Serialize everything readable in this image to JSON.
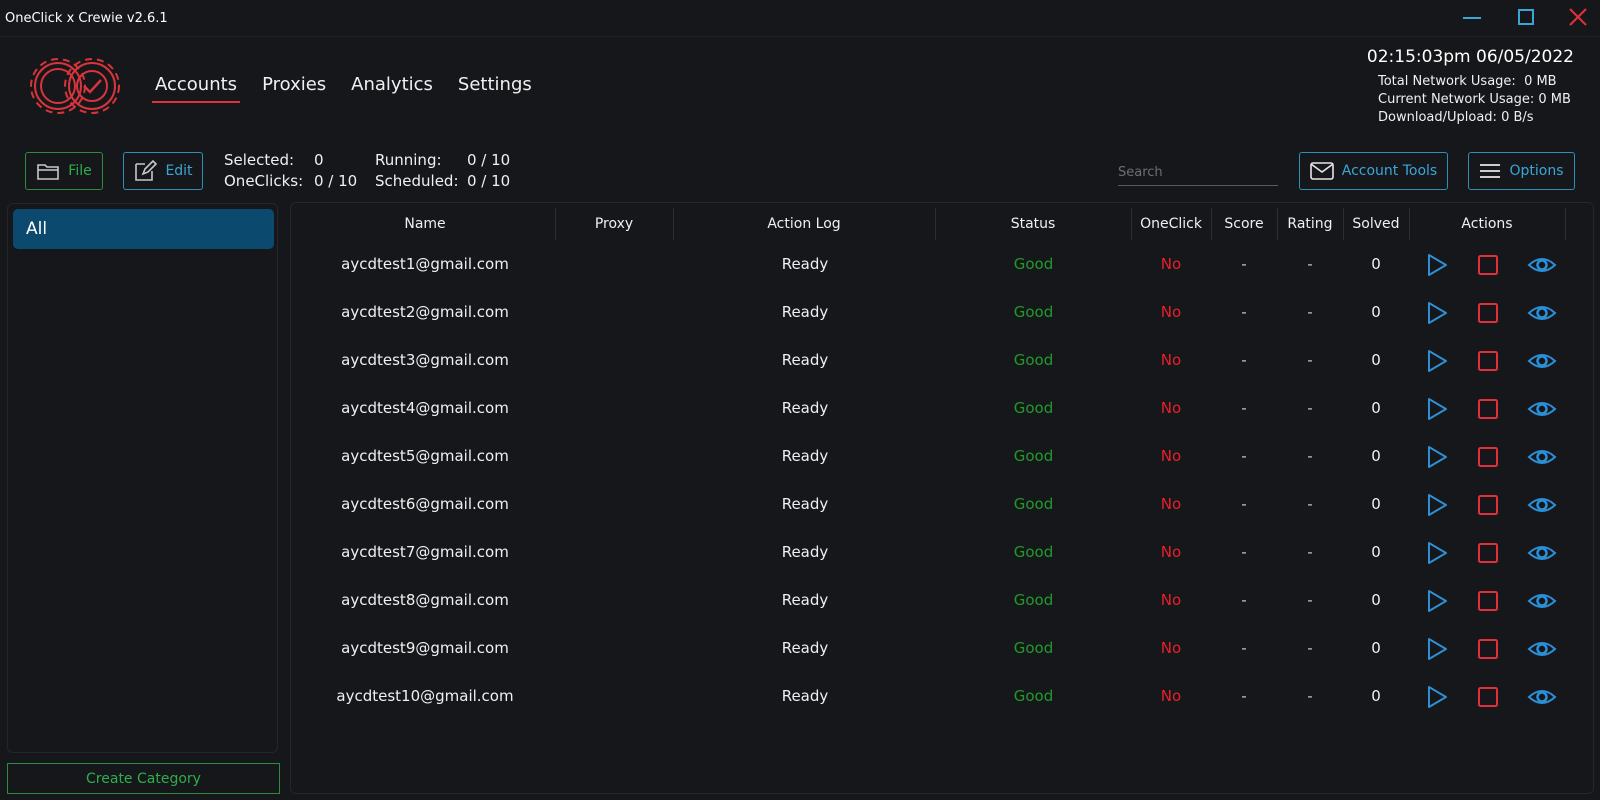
{
  "window": {
    "title": "OneClick x Crewie v2.6.1",
    "controls": [
      "minimize-icon",
      "maximize-icon",
      "close-icon"
    ]
  },
  "nav": {
    "tabs": [
      {
        "label": "Accounts",
        "active": true
      },
      {
        "label": "Proxies",
        "active": false
      },
      {
        "label": "Analytics",
        "active": false
      },
      {
        "label": "Settings",
        "active": false
      }
    ]
  },
  "header": {
    "clock": "02:15:03pm 06/05/2022",
    "total_network_label": "Total Network Usage:",
    "total_network_value": "0 MB",
    "current_network_label": "Current Network Usage:",
    "current_network_value": "0 MB",
    "download_upload_label": "Download/Upload:",
    "download_upload_value": "0 B/s"
  },
  "toolbar": {
    "file_label": "File",
    "edit_label": "Edit",
    "selected_label": "Selected:",
    "selected_value": "0",
    "oneclicks_label": "OneClicks:",
    "oneclicks_value": "0 / 10",
    "running_label": "Running:",
    "running_value": "0 / 10",
    "scheduled_label": "Scheduled:",
    "scheduled_value": "0 / 10",
    "search_placeholder": "Search",
    "account_tools_label": "Account Tools",
    "options_label": "Options"
  },
  "sidebar": {
    "categories": [
      "All"
    ],
    "create_category_label": "Create Category"
  },
  "table": {
    "columns": [
      "Name",
      "Proxy",
      "Action Log",
      "Status",
      "OneClick",
      "Score",
      "Rating",
      "Solved",
      "Actions"
    ],
    "rows": [
      {
        "name": "aycdtest1@gmail.com",
        "proxy": "",
        "log": "Ready",
        "status": "Good",
        "oneclick": "No",
        "score": "-",
        "rating": "-",
        "solved": "0"
      },
      {
        "name": "aycdtest2@gmail.com",
        "proxy": "",
        "log": "Ready",
        "status": "Good",
        "oneclick": "No",
        "score": "-",
        "rating": "-",
        "solved": "0"
      },
      {
        "name": "aycdtest3@gmail.com",
        "proxy": "",
        "log": "Ready",
        "status": "Good",
        "oneclick": "No",
        "score": "-",
        "rating": "-",
        "solved": "0"
      },
      {
        "name": "aycdtest4@gmail.com",
        "proxy": "",
        "log": "Ready",
        "status": "Good",
        "oneclick": "No",
        "score": "-",
        "rating": "-",
        "solved": "0"
      },
      {
        "name": "aycdtest5@gmail.com",
        "proxy": "",
        "log": "Ready",
        "status": "Good",
        "oneclick": "No",
        "score": "-",
        "rating": "-",
        "solved": "0"
      },
      {
        "name": "aycdtest6@gmail.com",
        "proxy": "",
        "log": "Ready",
        "status": "Good",
        "oneclick": "No",
        "score": "-",
        "rating": "-",
        "solved": "0"
      },
      {
        "name": "aycdtest7@gmail.com",
        "proxy": "",
        "log": "Ready",
        "status": "Good",
        "oneclick": "No",
        "score": "-",
        "rating": "-",
        "solved": "0"
      },
      {
        "name": "aycdtest8@gmail.com",
        "proxy": "",
        "log": "Ready",
        "status": "Good",
        "oneclick": "No",
        "score": "-",
        "rating": "-",
        "solved": "0"
      },
      {
        "name": "aycdtest9@gmail.com",
        "proxy": "",
        "log": "Ready",
        "status": "Good",
        "oneclick": "No",
        "score": "-",
        "rating": "-",
        "solved": "0"
      },
      {
        "name": "aycdtest10@gmail.com",
        "proxy": "",
        "log": "Ready",
        "status": "Good",
        "oneclick": "No",
        "score": "-",
        "rating": "-",
        "solved": "0"
      }
    ],
    "row_actions": [
      "play-icon",
      "stop-icon",
      "eye-icon"
    ]
  },
  "colors": {
    "background": "#16171b",
    "accent_blue": "#2c8fb8",
    "accent_green": "#2eae4a",
    "status_good": "#1e9b2b",
    "status_no": "#e8202a",
    "brand_red": "#e0303a",
    "selected_category": "#0b4a6e"
  }
}
